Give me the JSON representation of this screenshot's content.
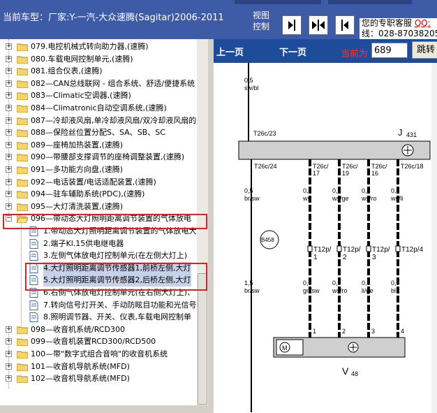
{
  "header": {
    "car_model": "当前车型：厂家:Y-一汽-大众速腾(Sagitar)2006-2011",
    "view_label": "视图控制",
    "contact_line1": "您的专职客服",
    "contact_qq": "QQ:",
    "contact_line2": "线：028-87038205"
  },
  "tree": {
    "items": [
      "079.电控机械式转向助力器,(速腾)",
      "080.车载电网控制单元,(速腾)",
      "081.组合仪表,(速腾)",
      "082—CAN总线联网 - 组合系统、舒适/便捷系统",
      "083—Climatic空调器,(速腾)",
      "084—Climatronic自动空调系统,(速腾)",
      "087—冷却液风扇,单冷却液风扇/双冷却液风扇的",
      "088—保险丝位置分配S、SA、SB、SC",
      "089—座椅加热装置,(速腾)",
      "090—带腰部支撑调节的座椅调整装置,(速腾)",
      "091—多功能方向盘,(速腾)",
      "092—电话装置/电话适配装置,(速腾)",
      "094—驻车辅助系统(PDC),(速腾)",
      "095—大灯清洗装置,(速腾)",
      "096—带动态大灯照明距离调节装置的气体放电"
    ],
    "children": [
      "1.带动态大灯照明距离调节装置的气体放电大",
      "2.端子Kl.15供电继电器",
      "3.左侧气体放电灯控制单元(在左侧大灯上)",
      "4.大灯照明距离调节传感器1,前桥左侧,大灯",
      "5.大灯照明距离调节传感器2,后桥左侧,大灯",
      "6.右侧气体放电灯控制单元(在右侧大灯上)、",
      "7.转向信号灯开关、手动防眩目功能和光信号",
      "8.照明调节器、开关、仪表,车载电网控制单"
    ],
    "tail_items": [
      "098—收音机系统/RCD300",
      "099—收音机装置RCD300/RCD500",
      "100—带\"数字式组合音响\"的收音机系统",
      "101—收音机导航系统(MFD)",
      "102—收音机导航系统(MFD)"
    ]
  },
  "viewer": {
    "prev_label": "上一页",
    "next_label": "下一页",
    "current_label": "当前为",
    "page_value": "689",
    "jump_label": "跳转"
  },
  "diagram": {
    "labels": {
      "top_wire": "0,5\nsw/bl",
      "j431": "J",
      "j431_sub": "431",
      "v48": "V",
      "v48_sub": "48",
      "b458": "B458"
    },
    "connectors_top": [
      "T26c/23"
    ],
    "connectors_mid": [
      "T26c/24",
      "T26c/\n17",
      "T26c/\n19",
      "T26c/\n16",
      "T26c/18"
    ],
    "wires_a": [
      "0,5\nbr/sw",
      "0,5\nws",
      "0,5\nws/ge",
      "0,5\nws/ro",
      "0,5\nws/li"
    ],
    "t12p": [
      "T12p/\n1",
      "T12p/\n2",
      "T12p/\n3",
      "T12p/4"
    ],
    "wires_b": [
      "1,5\nbr/sw",
      "0,5\ngn/sw",
      "0,5\nws/ro",
      "0,5\nli/ge",
      "0,5\nbl"
    ],
    "pins": [
      "1",
      "2",
      "3",
      "4"
    ]
  }
}
